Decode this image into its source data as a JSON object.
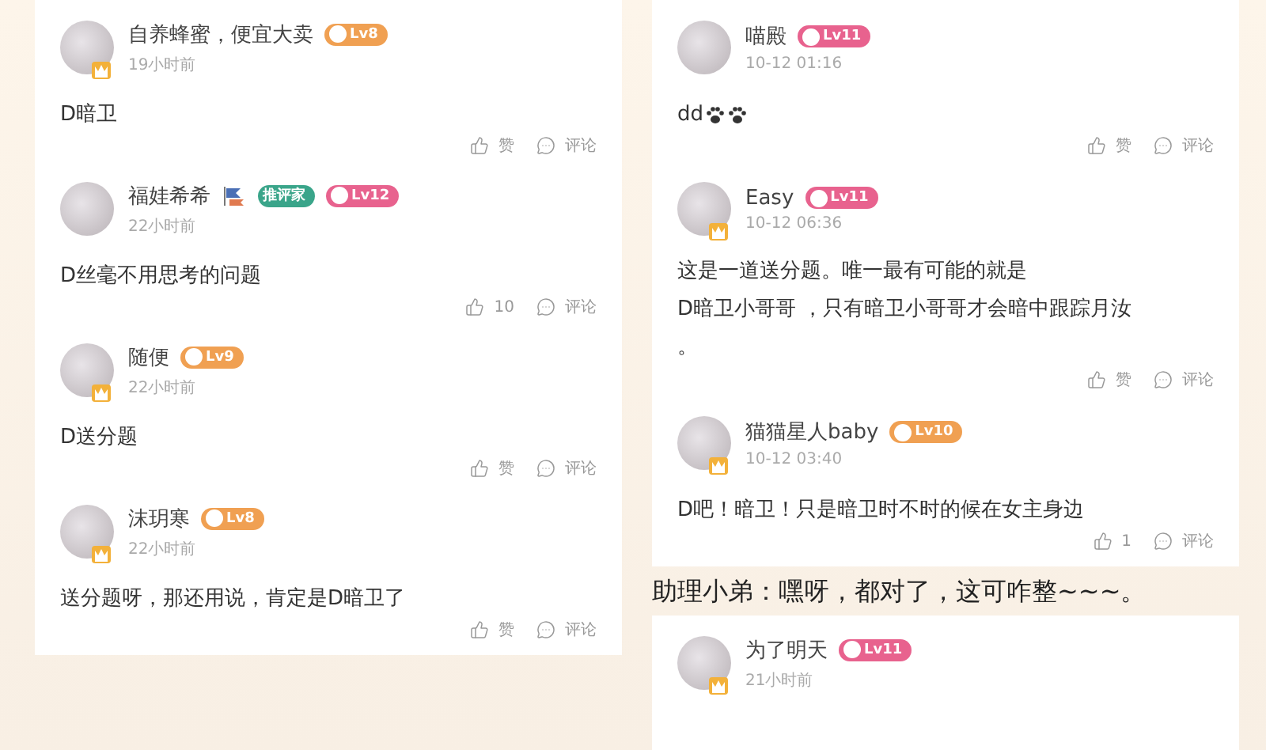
{
  "columns": [
    {
      "cards": [
        {
          "comments": [
            {
              "name": "自养蜂蜜，便宜大卖",
              "vip": true,
              "badges": [
                {
                  "kind": "cat",
                  "text": "Lv8"
                }
              ],
              "time": "19小时前",
              "content": "D暗卫",
              "likes": "赞",
              "reply": "评论"
            },
            {
              "name": "福娃希希",
              "vip": false,
              "flag": true,
              "badges": [
                {
                  "kind": "tag",
                  "text": "推评家"
                },
                {
                  "kind": "apple",
                  "text": "Lv12"
                }
              ],
              "time": "22小时前",
              "content": "D丝毫不用思考的问题",
              "likes": "10",
              "reply": "评论"
            },
            {
              "name": "随便",
              "vip": true,
              "badges": [
                {
                  "kind": "cat",
                  "text": "Lv9"
                }
              ],
              "time": "22小时前",
              "content": "D送分题",
              "likes": "赞",
              "reply": "评论"
            },
            {
              "name": "沫玥寒",
              "vip": true,
              "badges": [
                {
                  "kind": "cat",
                  "text": "Lv8"
                }
              ],
              "time": "22小时前",
              "content": "送分题呀，那还用说，肯定是D暗卫了",
              "likes": "赞",
              "reply": "评论"
            }
          ]
        }
      ]
    },
    {
      "cards": [
        {
          "comments": [
            {
              "name": "喵殿",
              "vip": false,
              "badges": [
                {
                  "kind": "apple",
                  "text": "Lv11"
                }
              ],
              "time": "10-12 01:16",
              "content": "dd",
              "stickers": [
                {
                  "kind": "paw"
                },
                {
                  "kind": "paw"
                }
              ],
              "likes": "赞",
              "reply": "评论"
            },
            {
              "name": "Easy",
              "vip": true,
              "badges": [
                {
                  "kind": "apple",
                  "text": "Lv11"
                }
              ],
              "time": "10-12 06:36",
              "content_lines": [
                "这是一道送分题。唯一最有可能的就是",
                "D暗卫小哥哥 ，只有暗卫小哥哥才会暗中跟踪月汝",
                "。"
              ],
              "likes": "赞",
              "reply": "评论"
            },
            {
              "name": "猫猫星人baby",
              "vip": true,
              "badges": [
                {
                  "kind": "cat",
                  "text": "Lv10"
                }
              ],
              "time": "10-12 03:40",
              "content": "D吧！暗卫！只是暗卫时不时的候在女主身边",
              "likes": "1",
              "reply": "评论"
            }
          ]
        }
      ],
      "caption": "助理小弟：嘿呀，都对了，这可咋整~~~。",
      "more": [
        {
          "name": "为了明天",
          "vip": true,
          "badges": [
            {
              "kind": "apple",
              "text": "Lv11"
            }
          ],
          "time": "21小时前"
        }
      ]
    }
  ]
}
